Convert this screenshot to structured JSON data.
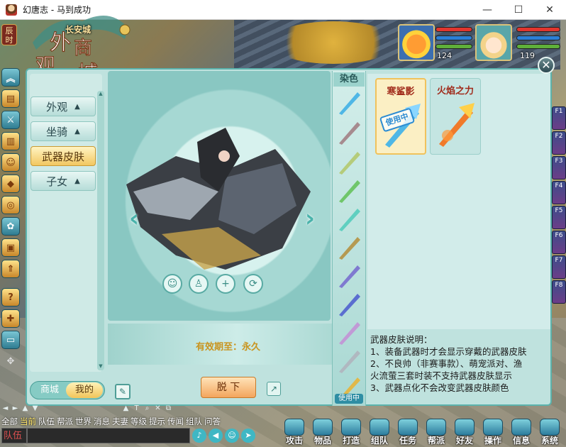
{
  "window": {
    "title": "幻唐志 - 马到成功",
    "minimize": "—",
    "maximize": "☐",
    "close": "✕"
  },
  "hud": {
    "time_badge": "辰时",
    "city": "长安城",
    "shop_title": [
      "外",
      "观",
      "商",
      "城"
    ],
    "pet_level": "124",
    "hero_level": "119"
  },
  "right_fkeys": [
    "F1",
    "F2",
    "F3",
    "F4",
    "F5",
    "F6",
    "F7",
    "F8"
  ],
  "mall": {
    "close": "✕",
    "categories": [
      {
        "label": "外观",
        "chevron": "▲"
      },
      {
        "label": "坐骑",
        "chevron": "▲"
      },
      {
        "label": "武器皮肤",
        "chevron": ""
      },
      {
        "label": "子女",
        "chevron": "▲"
      }
    ],
    "tabs": {
      "mall": "商城",
      "mine": "我的"
    },
    "validity": "有效期至：永久",
    "unequip": "脱 下",
    "dye_label": "染色",
    "dye_in_use": "使用中",
    "skins": [
      {
        "name": "寒鲨影",
        "status": "使用中"
      },
      {
        "name": "火焰之力"
      }
    ],
    "description": [
      "武器皮肤说明：",
      "1、装备武器时才会显示穿戴的武器皮肤",
      "2、不良帅（非赛事款）、萌宠派对、渔",
      "火流萤三套时装不支持武器皮肤显示",
      "3、武器点化不会改变武器皮肤颜色"
    ]
  },
  "chat": {
    "channels": [
      "全部",
      "当前",
      "队伍",
      "帮派",
      "世界",
      "消息",
      "夫妻",
      "等级",
      "提示",
      "传闻",
      "组队",
      "问答"
    ],
    "selected_channel": "队伍"
  },
  "actions": [
    "攻击",
    "物品",
    "打造",
    "组队",
    "任务",
    "帮派",
    "好友",
    "操作",
    "信息",
    "系统"
  ],
  "colors": {
    "panel": "#bfe2de",
    "accent": "#f2c761",
    "validity": "#c9941f"
  }
}
